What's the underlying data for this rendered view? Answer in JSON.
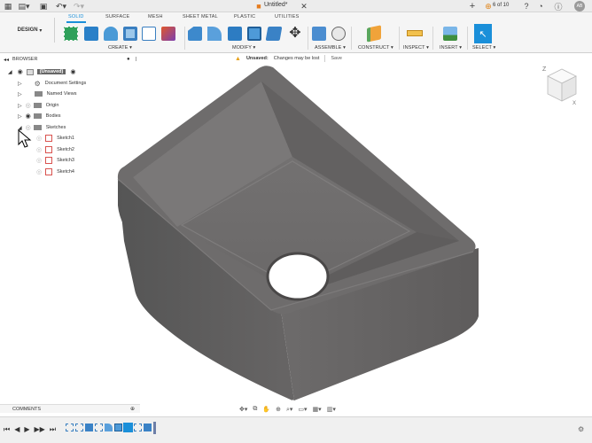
{
  "topbar": {
    "title": "Untitled*",
    "page_count": "6 of 10",
    "user_initials": "AB"
  },
  "ribbon": {
    "workspace": "DESIGN",
    "tabs": [
      "SOLID",
      "SURFACE",
      "MESH",
      "SHEET METAL",
      "PLASTIC",
      "UTILITIES"
    ],
    "active_tab": "SOLID",
    "groups": [
      "CREATE",
      "MODIFY",
      "ASSEMBLE",
      "CONSTRUCT",
      "INSPECT",
      "INSERT",
      "SELECT"
    ]
  },
  "save_strip": {
    "status": "Unsaved:",
    "message": "Changes may be lost",
    "save_label": "Save"
  },
  "browser": {
    "header": "BROWSER",
    "root": "(Unsaved)",
    "items": [
      "Document Settings",
      "Named Views",
      "Origin",
      "Bodies",
      "Sketches"
    ],
    "sketches": [
      "Sketch1",
      "Sketch2",
      "Sketch3",
      "Sketch4"
    ]
  },
  "comments": {
    "label": "COMMENTS"
  },
  "colors": {
    "accent": "#1a8fd9",
    "body_top": "#6a6868",
    "body_side": "#5a5858",
    "sketch_red": "#d9534f"
  }
}
